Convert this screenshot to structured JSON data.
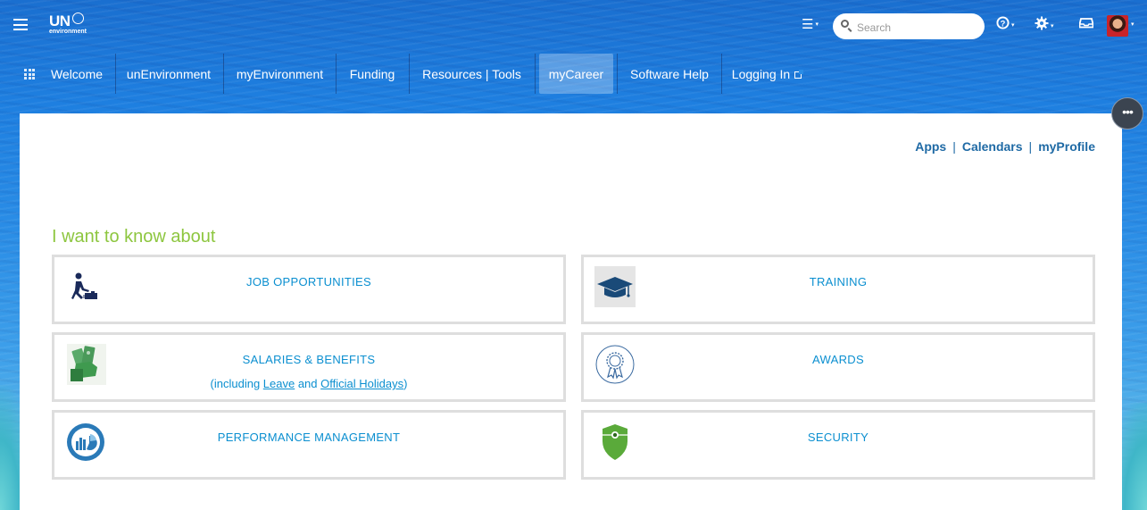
{
  "header": {
    "logo_main": "UN",
    "logo_sub": "environment",
    "search_placeholder": "Search",
    "icons": [
      "list-icon",
      "help-icon",
      "gear-icon",
      "inbox-icon"
    ]
  },
  "nav": {
    "items": [
      {
        "label": "Welcome"
      },
      {
        "label": "unEnvironment"
      },
      {
        "label": "myEnvironment"
      },
      {
        "label": "Funding"
      },
      {
        "label": "Resources | Tools"
      },
      {
        "label": "myCareer",
        "active": true
      },
      {
        "label": "Software Help"
      },
      {
        "label": "Logging In"
      }
    ]
  },
  "more_button": "•••",
  "panel": {
    "toplinks": [
      "Apps",
      "Calendars",
      "myProfile"
    ],
    "heading": "I want to know about",
    "cards": [
      {
        "title": "JOB OPPORTUNITIES",
        "icon": "running-person-icon"
      },
      {
        "title": "TRAINING",
        "icon": "graduation-cap-icon"
      },
      {
        "title": "SALARIES & BENEFITS",
        "icon": "money-hand-icon",
        "sub_prefix": "(including ",
        "link1": "Leave",
        "sub_mid": " and ",
        "link2": "Official Holidays",
        "sub_suffix": ")"
      },
      {
        "title": "AWARDS",
        "icon": "award-ribbon-icon"
      },
      {
        "title": "PERFORMANCE MANAGEMENT",
        "icon": "chart-circle-icon"
      },
      {
        "title": "SECURITY",
        "icon": "shield-icon"
      }
    ]
  },
  "colors": {
    "accent_green": "#8dc63f",
    "link_blue": "#0b8fd0",
    "toplink_blue": "#1f6aa5"
  }
}
